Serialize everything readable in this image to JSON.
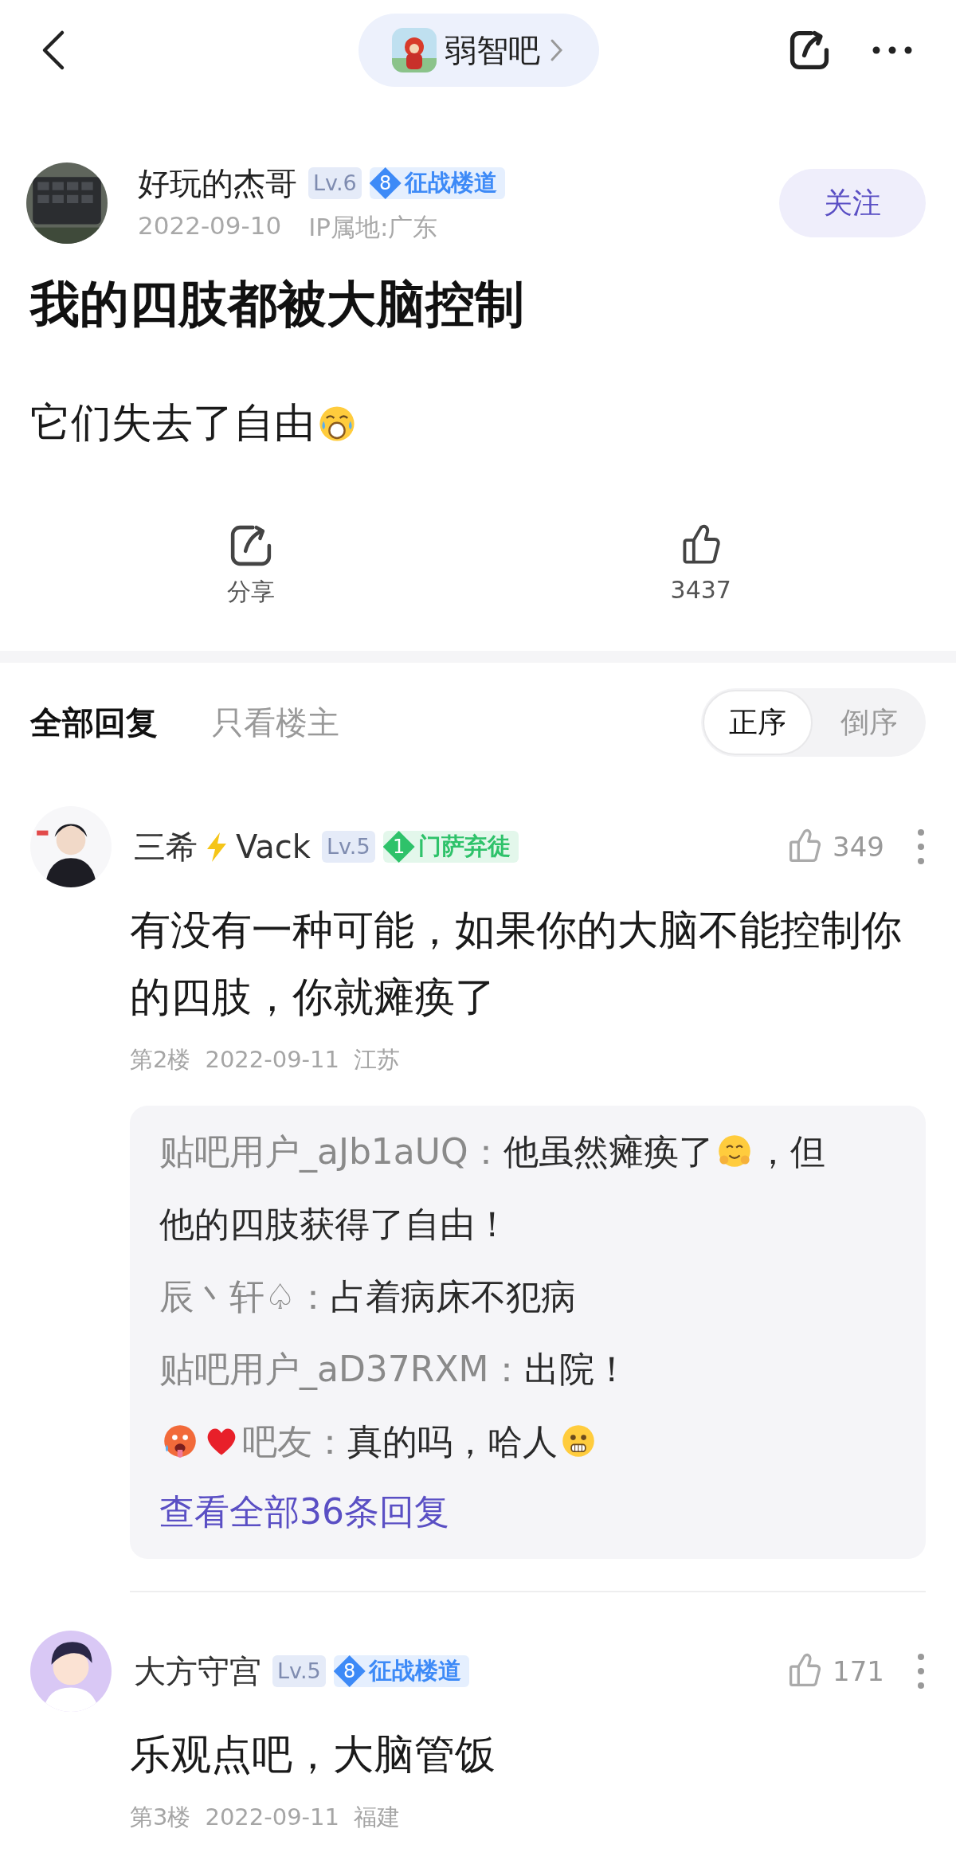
{
  "header": {
    "forum": "弱智吧"
  },
  "post": {
    "author": {
      "name": [
        {
          "kind": "text",
          "text": "好玩的杰哥"
        }
      ],
      "rank": "Lv.6",
      "badge": {
        "number": "8",
        "label": "征战楼道",
        "color": "#3d8af7"
      }
    },
    "date": "2022-09-10",
    "ip": "IP属地:广东",
    "follow": "关注",
    "title": "我的四肢都被大脑控制",
    "body": [
      {
        "kind": "text",
        "text": "它们失去了自由"
      },
      {
        "kind": "crying"
      }
    ],
    "actions": [
      {
        "kind": "share",
        "label": "分享"
      },
      {
        "kind": "like",
        "label": "3437"
      }
    ]
  },
  "reply_tabs": [
    {
      "label": "全部回复",
      "selected": true
    },
    {
      "label": "只看楼主",
      "selected": false
    }
  ],
  "sort": [
    {
      "label": "正序",
      "selected": true
    },
    {
      "label": "倒序",
      "selected": false
    }
  ],
  "comments": [
    {
      "name": [
        {
          "kind": "text",
          "text": "三希"
        },
        {
          "kind": "lightning"
        },
        {
          "kind": "text",
          "text": "Vack"
        }
      ],
      "rank": "Lv.5",
      "badge": {
        "number": "1",
        "label": "门萨弃徒",
        "color": "#2ec26a"
      },
      "likes": "349",
      "body": "有没有一种可能，如果你的大脑不能控制你的四肢，你就瘫痪了",
      "floor": "第2楼",
      "date": "2022-09-11",
      "location": "江苏",
      "replies": [
        {
          "name": [
            {
              "kind": "text",
              "text": "贴吧用户_aJb1aUQ："
            }
          ],
          "content": [
            {
              "kind": "text",
              "text": "他虽然瘫痪了"
            },
            {
              "kind": "blush"
            },
            {
              "kind": "text",
              "text": "，但"
            },
            {
              "kind": "text",
              "text": "他的四肢获得了自由！"
            }
          ]
        },
        {
          "name": [
            {
              "kind": "text",
              "text": "辰丶轩♤："
            }
          ],
          "content": [
            {
              "kind": "text",
              "text": "占着病床不犯病"
            }
          ]
        },
        {
          "name": [
            {
              "kind": "text",
              "text": "贴吧用户_aD37RXM："
            }
          ],
          "content": [
            {
              "kind": "text",
              "text": "出院！"
            }
          ]
        },
        {
          "name": [
            {
              "kind": "fever"
            },
            {
              "kind": "heart"
            },
            {
              "kind": "text",
              "text": "吧友："
            }
          ],
          "content": [
            {
              "kind": "text",
              "text": "真的吗，哈人"
            },
            {
              "kind": "scared"
            }
          ]
        }
      ],
      "more_replies": "查看全部36条回复"
    },
    {
      "name": [
        {
          "kind": "text",
          "text": "大方守宫"
        }
      ],
      "rank": "Lv.5",
      "badge": {
        "number": "8",
        "label": "征战楼道",
        "color": "#3d8af7"
      },
      "likes": "171",
      "body": "乐观点吧，大脑管饭",
      "floor": "第3楼",
      "date": "2022-09-11",
      "location": "福建"
    }
  ]
}
